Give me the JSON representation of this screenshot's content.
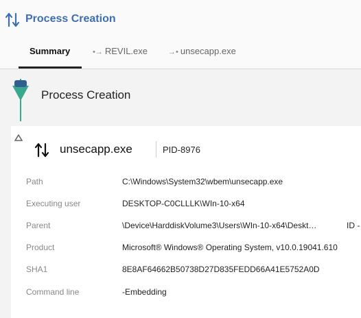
{
  "header": {
    "title": "Process Creation",
    "title_icon": "process-arrows-icon",
    "accent_color": "#3d6fb0"
  },
  "tabs": [
    {
      "label": "Summary",
      "active": true
    },
    {
      "label": "REVIL.exe",
      "prefix": "•→",
      "active": false
    },
    {
      "label": "unsecapp.exe",
      "prefix": "→•",
      "active": false
    }
  ],
  "timeline": {
    "section_title": "Process Creation",
    "marker_color": "#2f5f8f",
    "line_color": "#39a88d"
  },
  "card": {
    "process_name": "unsecapp.exe",
    "pid": "PID-8976",
    "fields": [
      {
        "label": "Path",
        "value": "C:\\Windows\\System32\\wbem\\unsecapp.exe"
      },
      {
        "label": "Executing user",
        "value": "DESKTOP-C0CLLLK\\WIn-10-x64"
      },
      {
        "label": "Parent",
        "value": "\\Device\\HarddiskVolume3\\Users\\WIn-10-x64\\Deskt…",
        "extra": "ID -"
      },
      {
        "label": "Product",
        "value": "Microsoft® Windows® Operating System, v10.0.19041.610"
      },
      {
        "label": "SHA1",
        "value": "8E8AF64662B50738D27D835FEDD66A41E5752A0D"
      },
      {
        "label": "Command line",
        "value": "-Embedding"
      }
    ]
  }
}
